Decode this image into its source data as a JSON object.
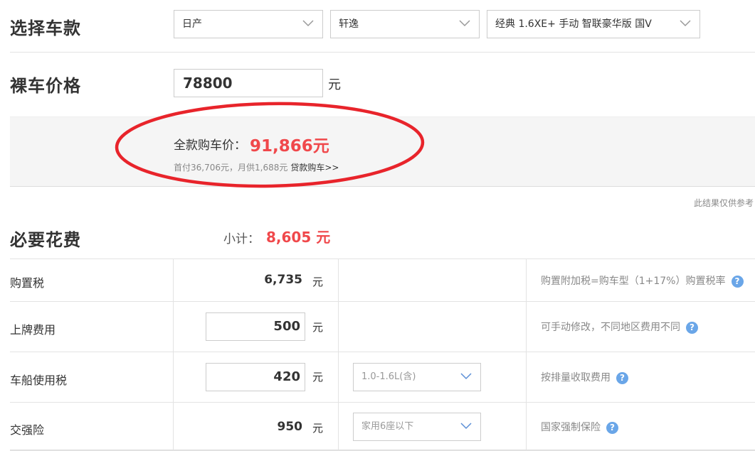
{
  "select_car": {
    "title": "选择车款",
    "brand": "日产",
    "series": "轩逸",
    "model": "经典 1.6XE+ 手动 智联豪华版 国V"
  },
  "bare_price": {
    "title": "裸车价格",
    "value": "78800",
    "unit": "元"
  },
  "summary": {
    "total_label": "全款购车价：",
    "total_value": "91,866元",
    "sub_text": "首付36,706元，月供1,688元",
    "loan_link": "贷款购车>>",
    "reference_note": "此结果仅供参考"
  },
  "required": {
    "title": "必要花费",
    "subtotal_label": "小计：",
    "subtotal_value": "8,605 元",
    "rows": [
      {
        "label": "购置税",
        "value": "6,735",
        "unit": "元",
        "hint": "购置附加税=购车型（1+17%）购置税率"
      },
      {
        "label": "上牌费用",
        "value": "500",
        "unit": "元",
        "hint": "可手动修改，不同地区费用不同"
      },
      {
        "label": "车船使用税",
        "value": "420",
        "unit": "元",
        "option": "1.0-1.6L(含)",
        "hint": "按排量收取费用"
      },
      {
        "label": "交强险",
        "value": "950",
        "unit": "元",
        "option": "家用6座以下",
        "hint": "国家强制保险"
      }
    ]
  },
  "colors": {
    "accent_red": "#f0484b",
    "help_blue": "#6aa6e8",
    "circle_red": "#e8242b"
  }
}
